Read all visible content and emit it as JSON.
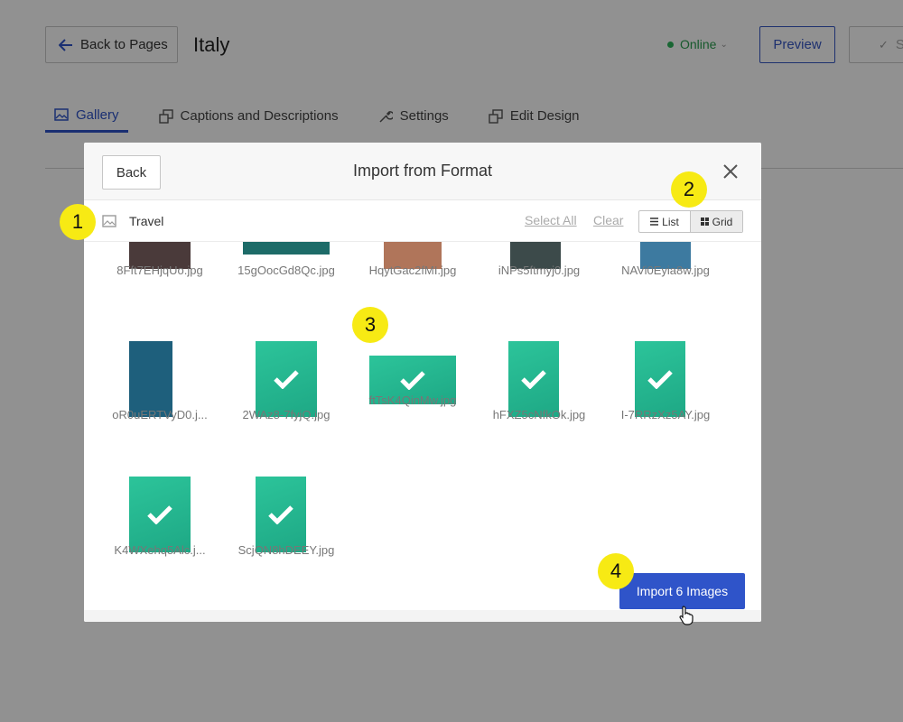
{
  "header": {
    "back_label": "Back to Pages",
    "page_title": "Italy",
    "status": "Online",
    "preview_label": "Preview",
    "save_label": "S"
  },
  "tabs": [
    {
      "label": "Gallery",
      "active": true
    },
    {
      "label": "Captions and Descriptions",
      "active": false
    },
    {
      "label": "Settings",
      "active": false
    },
    {
      "label": "Edit Design",
      "active": false
    }
  ],
  "modal": {
    "back_label": "Back",
    "title": "Import from Format",
    "folder_name": "Travel",
    "select_all": "Select All",
    "clear": "Clear",
    "view_list": "List",
    "view_grid": "Grid",
    "import_label": "Import 6 Images"
  },
  "images": [
    {
      "name": "8Fft7EHjqUo.jpg",
      "selected": false,
      "color": "#4a3a3a"
    },
    {
      "name": "15gOocGd8Qc.jpg",
      "selected": false,
      "color": "#1d6b68"
    },
    {
      "name": "HqytGac2fMI.jpg",
      "selected": false,
      "color": "#b0755a"
    },
    {
      "name": "iNPs5ftmyj0.jpg",
      "selected": false,
      "color": "#3c4a4a"
    },
    {
      "name": "NAVi0Eyia8w.jpg",
      "selected": false,
      "color": "#3d7aa0"
    },
    {
      "name": "oR0uERTVyD0.j...",
      "selected": false,
      "color": "#1e5f7c"
    },
    {
      "name": "2WAz8-7fyjQ.jpg",
      "selected": true,
      "color": "#2cc49a"
    },
    {
      "name": "ftTsK4QinMw.jpg",
      "selected": true,
      "color": "#2cc49a"
    },
    {
      "name": "hFXZ5cNfkOk.jpg",
      "selected": true,
      "color": "#2cc49a"
    },
    {
      "name": "I-7RRzXz5AY.jpg",
      "selected": true,
      "color": "#2cc49a"
    },
    {
      "name": "K4WXehq5Alc.j...",
      "selected": true,
      "color": "#2cc49a"
    },
    {
      "name": "ScjQN8hDEEY.jpg",
      "selected": true,
      "color": "#2cc49a"
    }
  ],
  "annotations": [
    "1",
    "2",
    "3",
    "4"
  ],
  "colors": {
    "accent": "#2f54c9",
    "selected": "#2cc49a",
    "badge": "#f7ea14",
    "online": "#2cb45a"
  }
}
